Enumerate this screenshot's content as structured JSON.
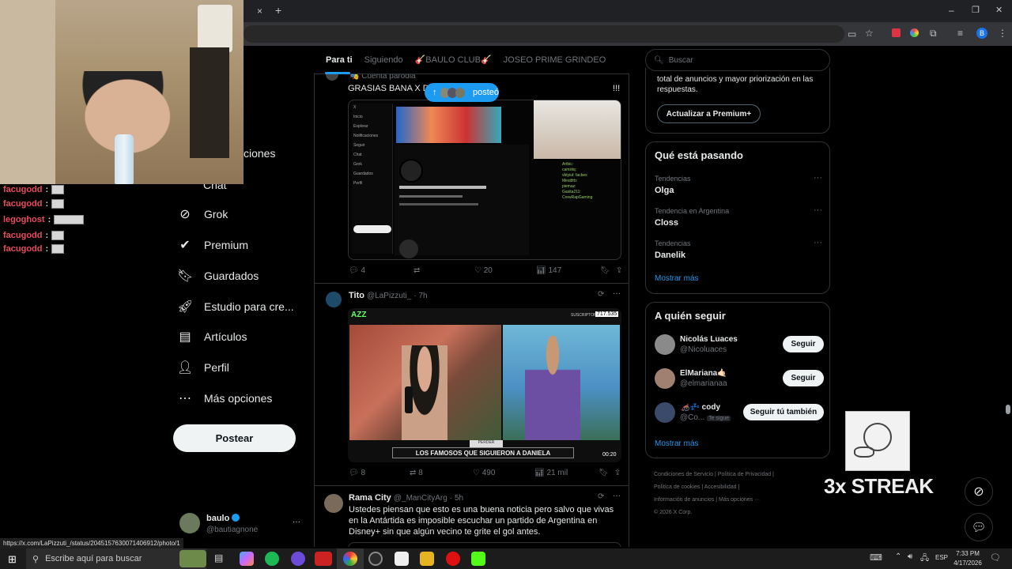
{
  "browser": {
    "tab_close": "×",
    "tab_new": "+",
    "win_min": "–",
    "win_restore": "❐",
    "win_close": "✕"
  },
  "chat": [
    {
      "user": "facugodd",
      "sep": ":"
    },
    {
      "user": "facugodd",
      "sep": ":"
    },
    {
      "user": "legoghost",
      "sep": ":"
    },
    {
      "user": "facugodd",
      "sep": ":"
    },
    {
      "user": "facugodd",
      "sep": ":"
    }
  ],
  "nav": {
    "partial_label": "ciones",
    "chat": "Chat",
    "items": [
      {
        "label": "Grok",
        "icon": "grok-icon"
      },
      {
        "label": "Premium",
        "icon": "premium-icon"
      },
      {
        "label": "Guardados",
        "icon": "bookmark-icon"
      },
      {
        "label": "Estudio para cre...",
        "icon": "rocket-icon"
      },
      {
        "label": "Artículos",
        "icon": "articles-icon"
      },
      {
        "label": "Perfil",
        "icon": "profile-icon"
      },
      {
        "label": "Más opciones",
        "icon": "more-icon"
      }
    ],
    "post_button": "Postear",
    "account": {
      "name": "baulo",
      "handle": "@bautiagnone",
      "more": "···"
    }
  },
  "feed": {
    "tabs": [
      "Para ti",
      "Siguiendo",
      "🎸BAULO CLUB🎸",
      "JOSEO PRIME GRINDEO"
    ],
    "posted_pill": "posteó",
    "tweet1": {
      "badge": "Cuenta parodia",
      "text_start": "GRASIAS BANA X DA",
      "text_end": "!!!",
      "replies": "4",
      "likes": "20",
      "views": "147"
    },
    "tweet2": {
      "name": "Tito",
      "handle": "@LaPizzuti_",
      "time": "· 7h",
      "video_brand": "AZZ",
      "subs_label": "SUSCRIPTORES",
      "subs_count": "717.535",
      "caption": "LOS FAMOSOS QUE SIGUIERON A DANIELA",
      "duration": "00:20",
      "replies": "8",
      "reposts": "8",
      "likes": "490",
      "views": "21 mil"
    },
    "tweet3": {
      "name": "Rama City",
      "handle": "@_ManCityArg",
      "time": "· 5h",
      "text": "Ustedes piensan que esto es una buena noticia pero salvo que vivas en la Antártida es imposible escuchar un partido de Argentina en Disney+ sin que algún vecino te grite el gol antes."
    }
  },
  "right": {
    "search_placeholder": "Buscar",
    "premium_text": "total de anuncios y mayor priorización en las respuestas.",
    "premium_button": "Actualizar a Premium+",
    "trends_title": "Qué está pasando",
    "trends": [
      {
        "cat": "Tendencias",
        "name": "Olga"
      },
      {
        "cat": "Tendencia en Argentina",
        "name": "Closs"
      },
      {
        "cat": "Tendencias",
        "name": "Danelik"
      }
    ],
    "show_more": "Mostrar más",
    "follow_title": "A quién seguir",
    "follows": [
      {
        "name": "Nicolás Luaces",
        "handle": "@Nicoluaces",
        "button": "Seguir"
      },
      {
        "name": "ElMariana🤙🏻",
        "handle": "@elmarianaa",
        "button": "Seguir"
      },
      {
        "name": "🦽💤 cody",
        "handle": "@Co...",
        "tag": "Te sigue",
        "button": "Seguir tú también"
      }
    ],
    "follow_more": "Mostrar más",
    "footer": [
      "Condiciones de Servicio",
      "Política de Privacidad",
      "Política de cookies",
      "Accesibilidad",
      "Información de anuncios",
      "Más opciones ···",
      "© 2026 X Corp."
    ]
  },
  "overlay": {
    "streak": "3x STREAK"
  },
  "status_url": "https://x.com/LaPizzuti_/status/2045157630071406912/photo/1",
  "taskbar": {
    "search_placeholder": "Escribe aquí para buscar",
    "lang": "ESP",
    "time": "7:33 PM",
    "date": "4/17/2026"
  }
}
